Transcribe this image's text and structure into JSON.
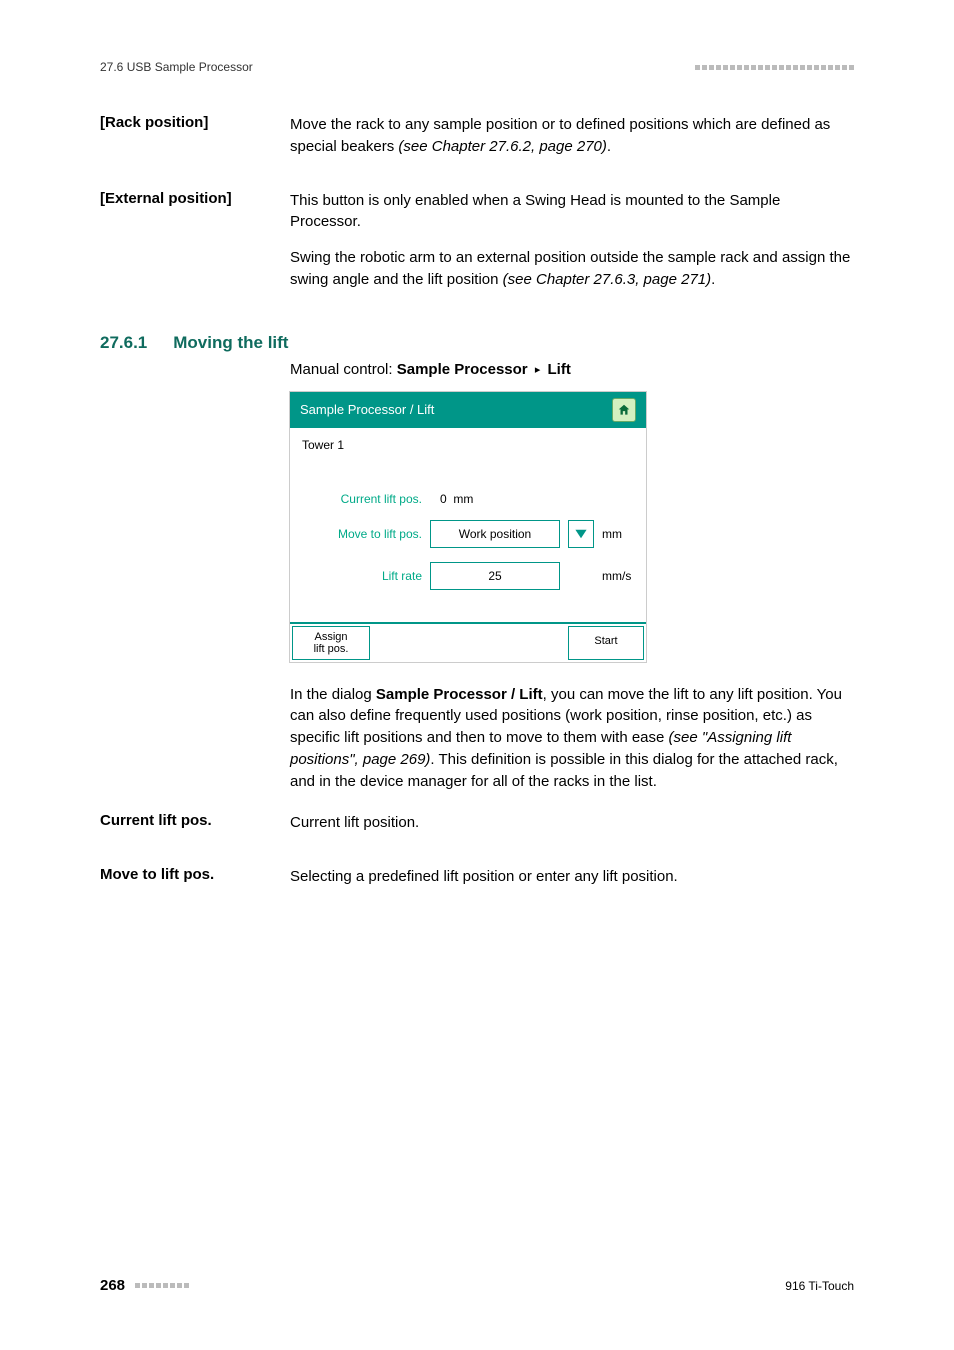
{
  "header": {
    "section_path": "27.6 USB Sample Processor"
  },
  "terms": [
    {
      "label": "[Rack position]",
      "paragraphs": [
        {
          "text": "Move the rack to any sample position or to defined positions which are defined as special beakers ",
          "ref": "(see Chapter 27.6.2, page 270)",
          "tail": "."
        }
      ]
    },
    {
      "label": "[External position]",
      "paragraphs": [
        {
          "text": "This button is only enabled when a Swing Head is mounted to the Sample Processor."
        },
        {
          "text": "Swing the robotic arm to an external position outside the sample rack and assign the swing angle and the lift position ",
          "ref": "(see Chapter 27.6.3, page 271)",
          "tail": "."
        }
      ]
    }
  ],
  "section": {
    "number": "27.6.1",
    "title": "Moving the lift",
    "breadcrumb_prefix": "Manual control: ",
    "breadcrumb_bold1": "Sample Processor",
    "breadcrumb_sep": "▸",
    "breadcrumb_bold2": "Lift"
  },
  "dialog": {
    "title": "Sample Processor / Lift",
    "tower": "Tower 1",
    "rows": {
      "current": {
        "label": "Current lift pos.",
        "value": "0",
        "unit": "mm"
      },
      "moveto": {
        "label": "Move to lift pos.",
        "value": "Work position",
        "unit": "mm"
      },
      "rate": {
        "label": "Lift rate",
        "value": "25",
        "unit": "mm/s"
      }
    },
    "footer": {
      "assign": "Assign\nlift pos.",
      "start": "Start"
    }
  },
  "after_dialog": {
    "p1_a": "In the dialog ",
    "p1_bold": "Sample Processor / Lift",
    "p1_b": ", you can move the lift to any lift position. You can also define frequently used positions (work position, rinse position, etc.) as specific lift positions and then to move to them with ease ",
    "p1_ref": "(see \"Assigning lift positions\", page 269)",
    "p1_c": ". This definition is possible in this dialog for the attached rack, and in the device manager for all of the racks in the list."
  },
  "defs": [
    {
      "label": "Current lift pos.",
      "desc": "Current lift position."
    },
    {
      "label": "Move to lift pos.",
      "desc": "Selecting a predefined lift position or enter any lift position."
    }
  ],
  "footer": {
    "page": "268",
    "product": "916 Ti-Touch"
  }
}
